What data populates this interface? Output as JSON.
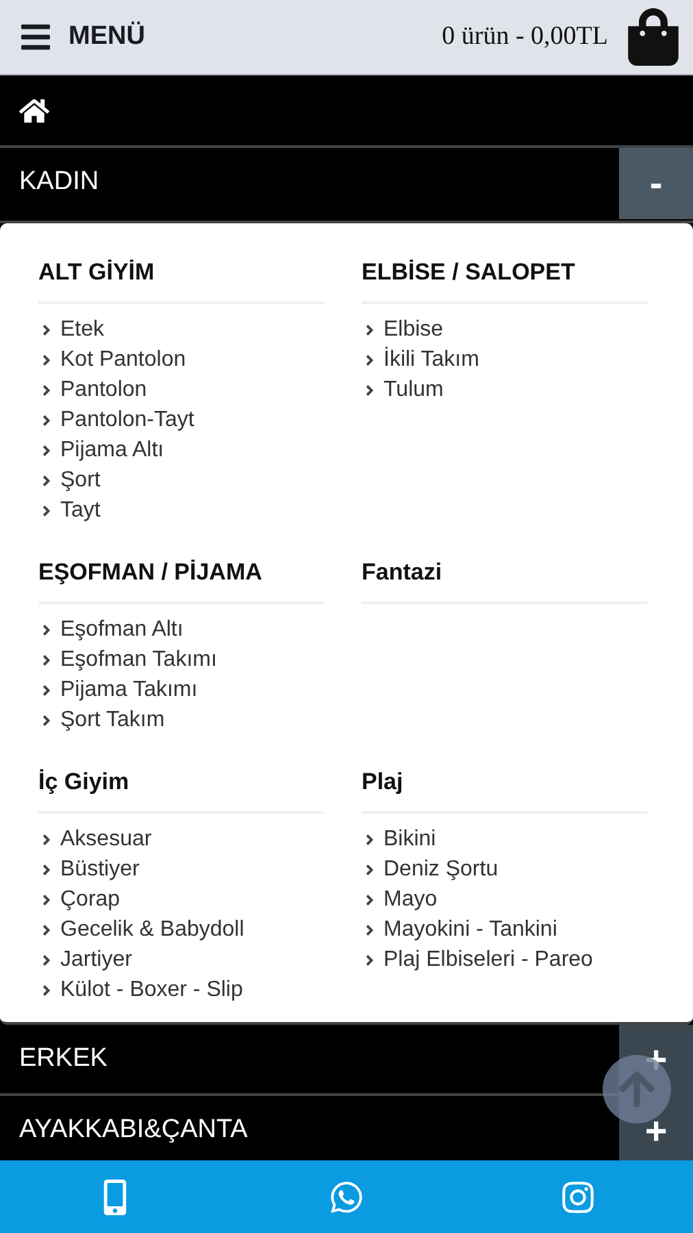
{
  "header": {
    "menu_label": "MENÜ",
    "cart_summary": "0 ürün - 0,00TL"
  },
  "nav": [
    {
      "kind": "home"
    },
    {
      "kind": "category",
      "label": "KADIN",
      "toggle": "-",
      "expanded": true,
      "groups": [
        {
          "title": "ALT GİYİM",
          "items": [
            "Etek",
            "Kot Pantolon",
            "Pantolon",
            "Pantolon-Tayt",
            "Pijama Altı",
            "Şort",
            "Tayt"
          ]
        },
        {
          "title": "ELBİSE / SALOPET",
          "items": [
            "Elbise",
            "İkili Takım",
            "Tulum"
          ]
        },
        {
          "title": "EŞOFMAN / PİJAMA",
          "items": [
            "Eşofman Altı",
            "Eşofman Takımı",
            "Pijama Takımı",
            "Şort Takım"
          ]
        },
        {
          "title": "Fantazi"
        },
        {
          "title": "İç Giyim",
          "items": [
            "Aksesuar",
            "Büstiyer",
            "Çorap",
            "Gecelik & Babydoll",
            "Jartiyer",
            "Külot - Boxer - Slip"
          ]
        },
        {
          "title": "Plaj",
          "items": [
            "Bikini",
            "Deniz Şortu",
            "Mayo",
            "Mayokini - Tankini",
            "Plaj Elbiseleri - Pareo"
          ]
        }
      ]
    },
    {
      "kind": "category",
      "label": "ERKEK",
      "toggle": "+",
      "expanded": false
    },
    {
      "kind": "category",
      "label": "AYAKKABI&ÇANTA",
      "toggle": "+",
      "expanded": false
    }
  ]
}
